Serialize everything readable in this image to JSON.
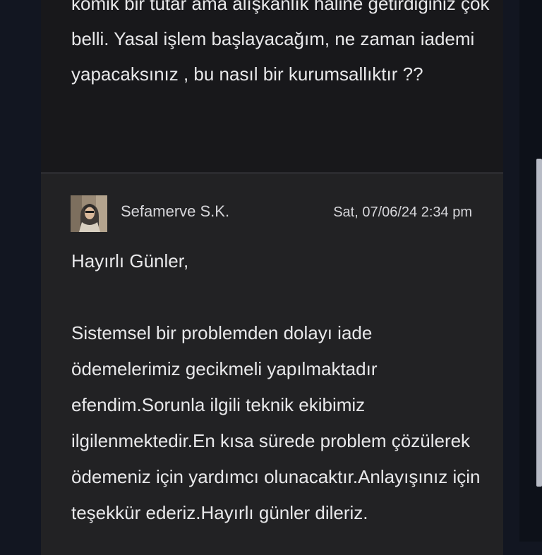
{
  "previous_message": {
    "text": "komik bir tutar ama alışkanlık haline getirdiginiz çok belli. Yasal işlem başlayacağım, ne zaman iademi yapacaksınız , bu nasıl bir kurumsallıktır ??"
  },
  "reply": {
    "author": "Sefamerve S.K.",
    "timestamp": "Sat, 07/06/24 2:34 pm",
    "greeting": "Hayırlı Günler,",
    "body": "Sistemsel bir problemden dolayı iade ödemelerimiz gecikmeli yapılmaktadır efendim.Sorunla ilgili teknik ekibimiz ilgilenmektedir.En kısa sürede problem çözülerek ödemeniz için yardımcı olunacaktır.Anlayışınız için teşekkür ederiz.Hayırlı günler dileriz."
  },
  "colors": {
    "page_background": "#121621",
    "card_background": "#18181b",
    "reply_background": "#222224",
    "text": "#e8e8ea"
  }
}
